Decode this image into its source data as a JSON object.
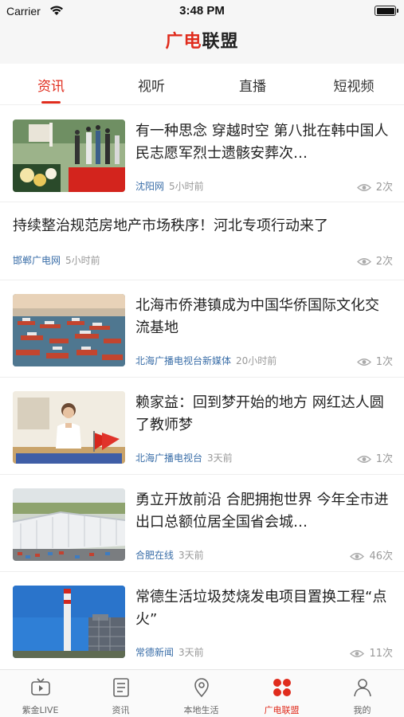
{
  "status_bar": {
    "carrier": "Carrier",
    "time": "3:48 PM"
  },
  "header": {
    "brand_part1": "广电",
    "brand_part2": "联盟"
  },
  "tabs": [
    {
      "label": "资讯",
      "active": true
    },
    {
      "label": "视听",
      "active": false
    },
    {
      "label": "直播",
      "active": false
    },
    {
      "label": "短视频",
      "active": false
    }
  ],
  "feed": [
    {
      "title": "有一种思念 穿越时空 第八批在韩中国人民志愿军烈士遗骸安葬次…",
      "source": "沈阳网",
      "time": "5小时前",
      "views": "2次",
      "has_image": true,
      "image": "ceremony"
    },
    {
      "title": "持续整治规范房地产市场秩序！河北专项行动来了",
      "source": "邯郸广电网",
      "time": "5小时前",
      "views": "2次",
      "has_image": false
    },
    {
      "title": "北海市侨港镇成为中国华侨国际文化交流基地",
      "source": "北海广播电视台新媒体",
      "time": "20小时前",
      "views": "1次",
      "has_image": true,
      "image": "harbor"
    },
    {
      "title": "赖家益：回到梦开始的地方 网红达人圆了教师梦",
      "source": "北海广播电视台",
      "time": "3天前",
      "views": "1次",
      "has_image": true,
      "image": "classroom"
    },
    {
      "title": "勇立开放前沿 合肥拥抱世界 今年全市进出口总额位居全国省会城…",
      "source": "合肥在线",
      "time": "3天前",
      "views": "46次",
      "has_image": true,
      "image": "port"
    },
    {
      "title": "常德生活垃圾焚烧发电项目置换工程“点火”",
      "source": "常德新闻",
      "time": "3天前",
      "views": "11次",
      "has_image": true,
      "image": "chimney"
    }
  ],
  "bottom_nav": [
    {
      "label": "紫金LIVE",
      "icon": "tv-icon",
      "active": false
    },
    {
      "label": "资讯",
      "icon": "news-icon",
      "active": false
    },
    {
      "label": "本地生活",
      "icon": "location-icon",
      "active": false
    },
    {
      "label": "广电联盟",
      "icon": "alliance-icon",
      "active": true
    },
    {
      "label": "我的",
      "icon": "user-icon",
      "active": false
    }
  ],
  "colors": {
    "accent": "#e02c1d",
    "source_link": "#3a6ea8",
    "muted": "#999999"
  }
}
